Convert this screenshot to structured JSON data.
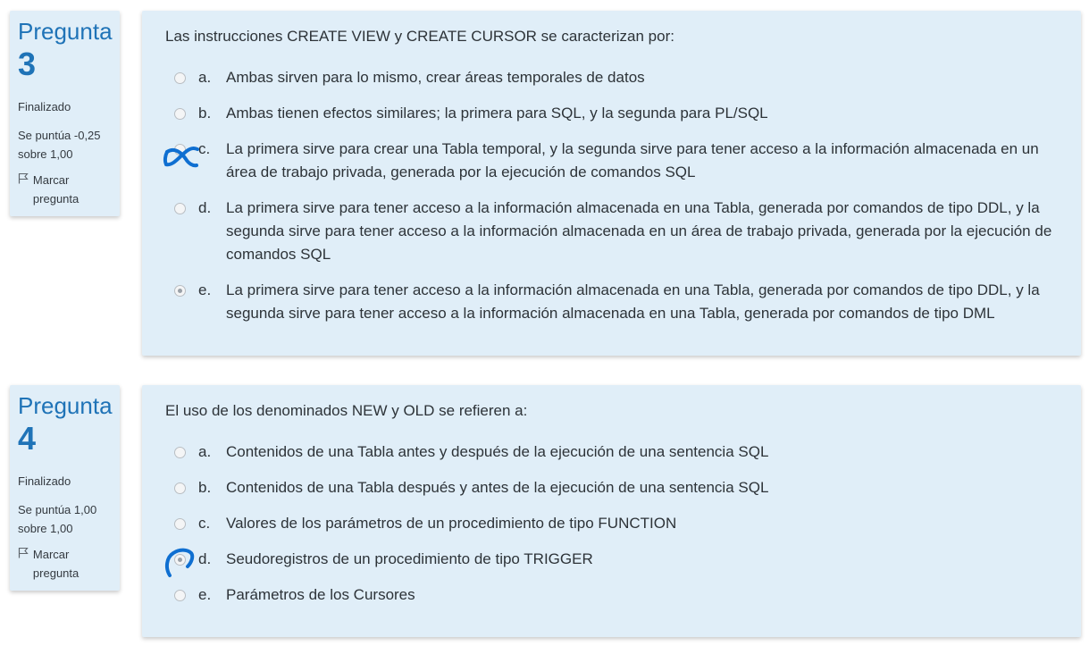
{
  "questions": [
    {
      "label": "Pregunta",
      "number": "3",
      "state": "Finalizado",
      "grade": "Se puntúa -0,25 sobre 1,00",
      "flag_label": "Marcar pregunta",
      "text": "Las instrucciones CREATE VIEW y CREATE CURSOR se caracterizan por:",
      "options": [
        {
          "letter": "a.",
          "text": "Ambas sirven para lo mismo, crear áreas temporales de datos"
        },
        {
          "letter": "b.",
          "text": "Ambas tienen efectos similares; la primera para SQL, y la segunda para PL/SQL"
        },
        {
          "letter": "c.",
          "text": "La primera sirve para crear una Tabla temporal, y la segunda sirve para tener acceso a la información almacenada en un área de trabajo privada, generada por la ejecución de comandos SQL"
        },
        {
          "letter": "d.",
          "text": "La primera sirve para tener acceso a la información almacenada en una Tabla, generada por comandos de tipo DDL, y la segunda sirve para tener acceso a la información almacenada en un área de trabajo privada, generada por la ejecución de comandos SQL"
        },
        {
          "letter": "e.",
          "text": "La primera sirve para tener acceso a la información almacenada en una Tabla, generada por comandos de tipo DDL, y la segunda sirve para tener acceso a la información almacenada en una Tabla, generada por comandos de tipo DML"
        }
      ],
      "selected_option": "e."
    },
    {
      "label": "Pregunta",
      "number": "4",
      "state": "Finalizado",
      "grade": "Se puntúa 1,00 sobre 1,00",
      "flag_label": "Marcar pregunta",
      "text": "El uso de los denominados NEW y OLD se refieren a:",
      "options": [
        {
          "letter": "a.",
          "text": "Contenidos de una Tabla antes y después de la ejecución de una sentencia SQL"
        },
        {
          "letter": "b.",
          "text": "Contenidos de una Tabla después y antes de la ejecución de una sentencia SQL"
        },
        {
          "letter": "c.",
          "text": "Valores de los parámetros de un procedimiento de tipo FUNCTION"
        },
        {
          "letter": "d.",
          "text": "Seudoregistros de un procedimiento de tipo TRIGGER"
        },
        {
          "letter": "e.",
          "text": "Parámetros de los Cursores"
        }
      ],
      "selected_option": "d."
    }
  ],
  "colors": {
    "accent": "#1f73b7",
    "panel_bg": "#e0eef8",
    "pen_mark": "#0f6fd1"
  },
  "icons": {
    "flag": "flag-outline-icon",
    "pen_x": "handwritten-x-mark",
    "pen_circle": "handwritten-circle-mark"
  }
}
